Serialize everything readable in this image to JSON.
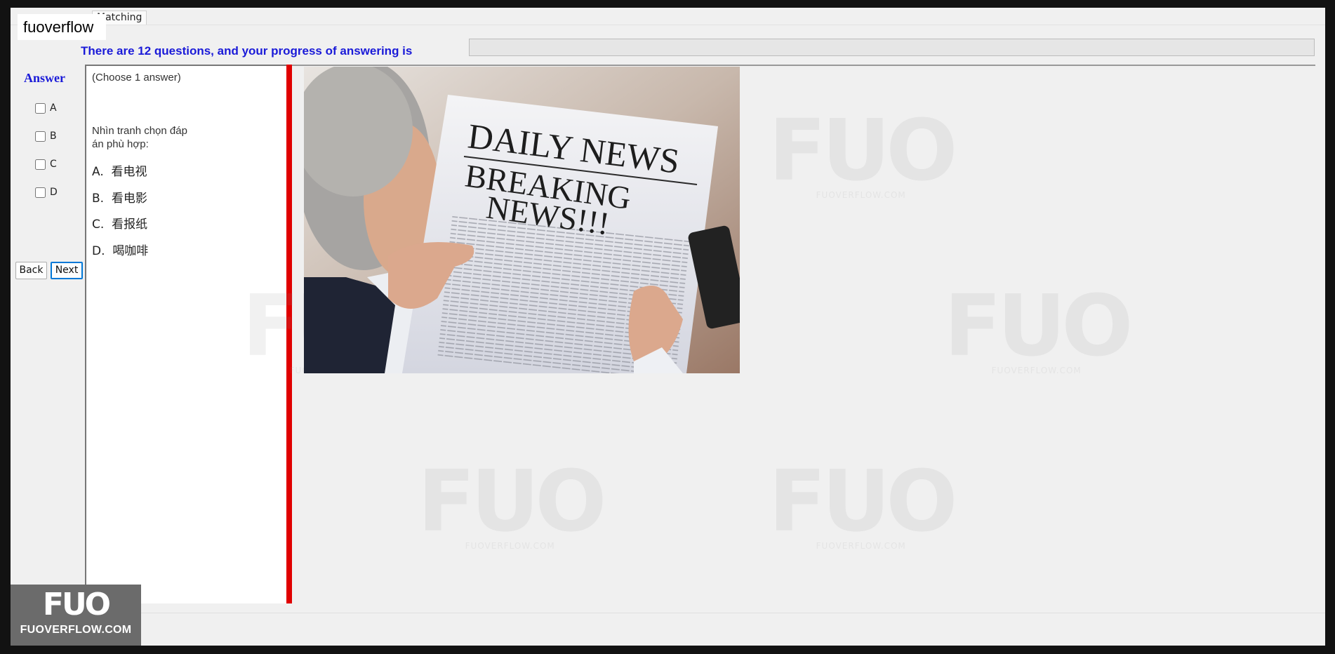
{
  "tabs": {
    "active_label": "Matching"
  },
  "brand": {
    "label": "fuoverflow"
  },
  "progress": {
    "label": "There are 12 questions, and your progress of answering is",
    "fraction": 0
  },
  "answer_panel": {
    "title": "Answer",
    "options": [
      {
        "label": "A",
        "checked": false
      },
      {
        "label": "B",
        "checked": false
      },
      {
        "label": "C",
        "checked": false
      },
      {
        "label": "D",
        "checked": false
      }
    ],
    "back_label": "Back",
    "next_label": "Next"
  },
  "question": {
    "instruction": "(Choose 1 answer)",
    "prompt": "Nhìn tranh chọn đáp án phù hợp:",
    "choices": [
      {
        "letter": "A.",
        "text": "看电视"
      },
      {
        "letter": "B.",
        "text": "看电影"
      },
      {
        "letter": "C.",
        "text": "看报纸"
      },
      {
        "letter": "D.",
        "text": "喝咖啡"
      }
    ]
  },
  "image": {
    "headline_1": "DAILY NEWS",
    "headline_2": "BREAKING",
    "headline_3": "NEWS!!!"
  },
  "watermark": {
    "logo": "FUO",
    "site": "FUOVERFLOW.COM"
  },
  "footer_logo": {
    "logo": "FUO",
    "site": "FUOVERFLOW.COM"
  },
  "colors": {
    "accent_blue": "#1a1ad8",
    "divider_red": "#e00000",
    "progress_green": "#06b025"
  }
}
